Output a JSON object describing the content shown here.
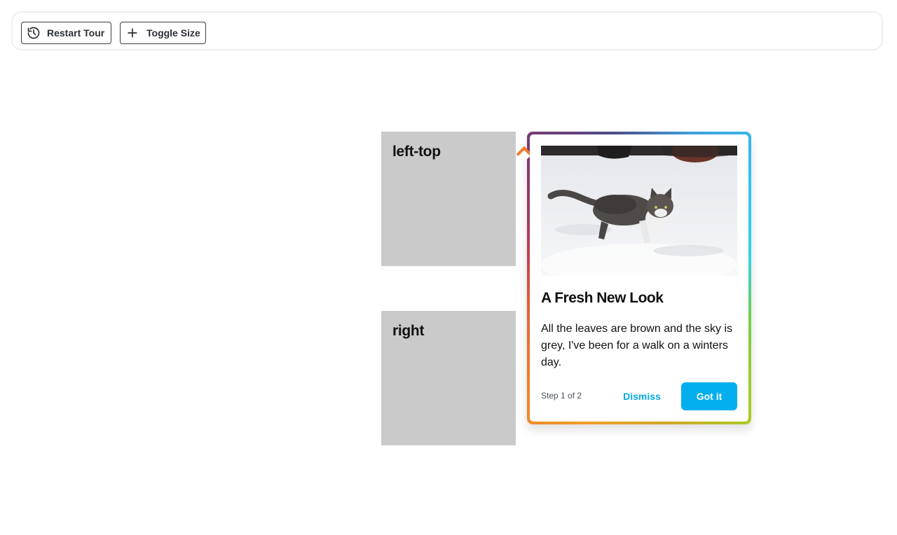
{
  "toolbar": {
    "restart_label": "Restart Tour",
    "toggle_label": "Toggle Size",
    "restart_icon": "history-icon",
    "toggle_icon": "plus-icon"
  },
  "targets": [
    {
      "label": "left-top"
    },
    {
      "label": "right"
    }
  ],
  "popover": {
    "image_alt": "cat-in-snow-image",
    "title": "A Fresh New Look",
    "body": "All the leaves are brown and the sky is grey, I've been for a walk on a winters day.",
    "step_text": "Step 1 of 2",
    "dismiss_label": "Dismiss",
    "confirm_label": "Got it",
    "accent_color": "#03aeef"
  }
}
